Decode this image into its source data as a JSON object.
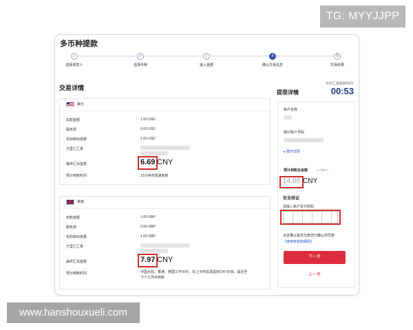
{
  "watermarks": {
    "tg": "TG: MYYJJPP",
    "site": "www.hanshouxueli.com"
  },
  "page": {
    "title": "多币种提款"
  },
  "steps": [
    {
      "label": "选择收款人",
      "state": "done"
    },
    {
      "label": "选择币种",
      "state": "done"
    },
    {
      "label": "输入金额",
      "state": "done"
    },
    {
      "label": "确认交易信息",
      "state": "active",
      "number": "4"
    },
    {
      "label": "交易结果",
      "state": "pending",
      "number": "5"
    }
  ],
  "details": {
    "title": "交易详情",
    "usd": {
      "currency": "美元",
      "rows": [
        {
          "label": "扣款金额",
          "value": "1.00 USD"
        },
        {
          "label": "服务费",
          "value": "0.00 USD"
        },
        {
          "label": "实际转出金额",
          "value": "1.00 USD"
        },
        {
          "label": "万里汇汇率",
          "value": ""
        }
      ],
      "final_label": "最终汇出金额",
      "final_amount": "6.69",
      "final_currency": "CNY",
      "eta_label": "预计到账时间",
      "eta_value": "15分钟内极速到账"
    },
    "gbp": {
      "currency": "英镑",
      "rows": [
        {
          "label": "扣款金额",
          "value": "1.00 GBP"
        },
        {
          "label": "服务费",
          "value": "0.00 GBP"
        },
        {
          "label": "实际转出金额",
          "value": "1.00 GBP"
        },
        {
          "label": "万里汇汇率",
          "value": ""
        }
      ],
      "final_label": "最终汇出金额",
      "final_amount": "7.97",
      "final_currency": "CNY",
      "eta_label": "预计到账时间",
      "eta_line1": "中国大陆、香港、英国工作日中，非上午时段发起的CNY交易，最迟至",
      "eta_line2": "下个工作日到账"
    }
  },
  "withdraw": {
    "title": "提现详情",
    "rt_label": "实时汇率刷新时间",
    "timer": "00:53",
    "account_name_label": "账户名称",
    "bank_account_label": "银行账户号码",
    "expand_link": "▸ 展开详情",
    "total_label": "预计到账总金额",
    "total_note": "(2个账户)",
    "total_amount": "14.66",
    "total_currency": "CNY",
    "security_title": "安全验证",
    "password_prompt": "请输入账户支付密码",
    "terms_line1": "点击确认提交代表您已确认并同意",
    "terms_link": "《使用条款和细则》",
    "next_button": "下一步",
    "prev_button": "上一步"
  },
  "colors": {
    "accent": "#dc2d3c",
    "brand_blue": "#1e3a8a",
    "highlight": "#d42b2b"
  }
}
